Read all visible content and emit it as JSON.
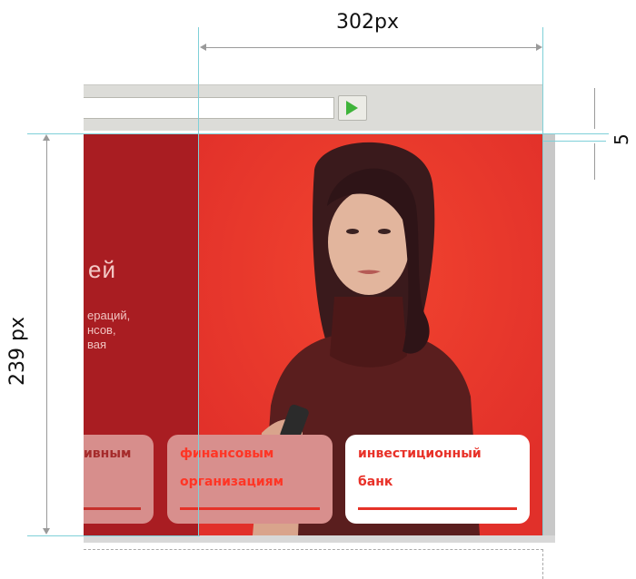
{
  "browser": {
    "go_icon": "play-triangle-icon",
    "go_color": "#3fb43a"
  },
  "site": {
    "background_color": "#e7342b",
    "left_panel_color": "#a91d22",
    "heading": "ей",
    "paragraph": "ераций,\nнсов,\nвая",
    "cards": [
      {
        "line1": "ивным",
        "line2": ""
      },
      {
        "line1": "финансовым",
        "line2": "организациям"
      },
      {
        "line1": "инвестиционный",
        "line2": "банк"
      }
    ]
  },
  "measurements": {
    "width_label": "302px",
    "height_label": "239 px",
    "gap_label": "5 px",
    "guide_color": "#7fd0d8"
  }
}
